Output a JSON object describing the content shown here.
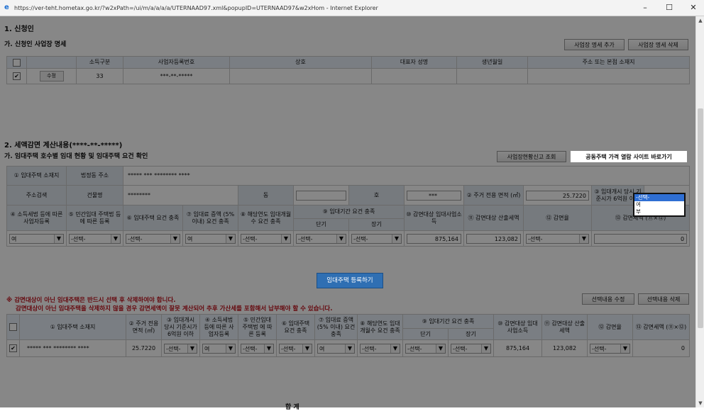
{
  "window": {
    "url": "https://ver-teht.hometax.go.kr/?w2xPath=/ui/m/a/a/a/a/UTERNAAD97.xml&popupID=UTERNAAD97&w2xHom - Internet Explorer",
    "minimize": "–",
    "maximize": "☐",
    "close": "✕"
  },
  "section1": {
    "title": "1. 신청인",
    "subtitle": "가. 신청인 사업장 명세",
    "add_btn": "사업장 명세 추가",
    "delete_btn": "사업장 명세 삭제",
    "columns": [
      "소득구분",
      "사업자등록번호",
      "상호",
      "대표자 성명",
      "생년월일",
      "주소 또는 본점 소재지"
    ],
    "row": {
      "check": "✔",
      "action": "수정",
      "code": "33",
      "bizno": "***-**-*****",
      "name": "",
      "rep": "",
      "birth": "",
      "addr": ""
    }
  },
  "section2": {
    "title": "2. 세액감면 계산내용(****-**-*****)",
    "subtitle": "가. 임대주택 호수별 임대 현황 및 임대주택 요건 확인",
    "business_btn": "사업장현황신고 조회",
    "link_btn": "공동주택 가격 열람 사이트 바로가기",
    "address_label": "① 임대주택 소재지",
    "legal_dong_label": "법정동 주소",
    "legal_dong_value": "***** *** ******** ****",
    "detail_addr_label": "주소검색",
    "building_label": "건물명",
    "building_value": "********",
    "dong_label": "동",
    "ho_label": "호",
    "ho_value": "***",
    "area_label": "② 주거 전용 면적 (㎡)",
    "area_value": "25.7220",
    "price_label": "③ 임대개시 당시 기준시가 6억원 이하",
    "income_tax_label": "④ 소득세법 등에 따른 사업자등록",
    "rental_law_label": "⑤ 민간임대 주택법 등에 따른 등록",
    "req_label": "⑥ 임대주택 요건 충족",
    "rent_inc_label": "⑦ 임대료 증액 (5% 이내) 요건 충족",
    "year_count_label": "⑧ 해당연도 임대개월수 요건 충족",
    "period_label": "⑨ 임대기간 요건 충족",
    "short_label": "단기",
    "long_label": "장기",
    "reduce_income_label": "⑩ 감면대상 임대사업소득",
    "calc_tax_label": "⑪ 감면대상 산출세액",
    "rate_label": "⑫ 감면율",
    "reduce_tax_label": "⑬ 감면세액 (⑪×⑫)",
    "row": {
      "income_tax": "여",
      "rental_law": "-선택-",
      "req": "-선택-",
      "rent_inc": "여",
      "year_count": "-선택-",
      "short": "-선택-",
      "long": "-선택-",
      "reduce_income": "875,164",
      "calc_tax": "123,082",
      "rate": "-선택-",
      "reduce_tax": "0"
    },
    "dropdown_options": [
      "-선택-",
      "여",
      "부"
    ],
    "register_btn": "임대주택 등록하기",
    "warning1": "※ 감면대상이 아닌 임대주택은 반드시 선택 후 삭제하여야 합니다.",
    "warning2": "감면대상이 아닌 임대주택을 삭제하지 않을 경우 감면세액이 잘못 계산되어 추후 가산세를 포함해서 납부해야 할 수 있습니다.",
    "edit_sel_btn": "선택내용 수정",
    "delete_sel_btn": "선택내용 삭제"
  },
  "list": {
    "address_col": "① 임대주택 소재지",
    "area_col": "② 주거 전용 면적 (㎡)",
    "price_col": "③ 임대개시 당시 기준시가 6억원 이하",
    "income_tax_col": "④ 소득세법 등에 따른 사업자등록",
    "rental_law_col": "⑤ 민간임대 주택법 에 따른 등록",
    "req_col": "⑥ 임대주택 요건 충족",
    "rent_inc_col": "⑦ 임대료 증액 (5% 이내) 요건 충족",
    "year_count_col": "⑧ 해당연도 임대개월수 요건 충족",
    "period_col": "⑨ 임대기간 요건 충족",
    "short_col": "단기",
    "long_col": "장기",
    "reduce_income_col": "⑩ 감면대상 임대사업소득",
    "calc_tax_col": "⑪ 감면대상 산출세액",
    "rate_col": "⑫ 감면율",
    "reduce_tax_col": "⑬ 감면세액 (⑪×⑫)",
    "row": {
      "check": "✔",
      "address": "***** *** ******** ****",
      "area": "25.7220",
      "price": "-선택-",
      "income_tax": "여",
      "rental_law": "-선택-",
      "req": "-선택-",
      "rent_inc": "여",
      "year_count": "-선택-",
      "short": "-선택-",
      "long": "-선택-",
      "reduce_income": "875,164",
      "calc_tax": "123,082",
      "rate": "-선택-",
      "reduce_tax": "0"
    },
    "footer_text": "합 계"
  }
}
